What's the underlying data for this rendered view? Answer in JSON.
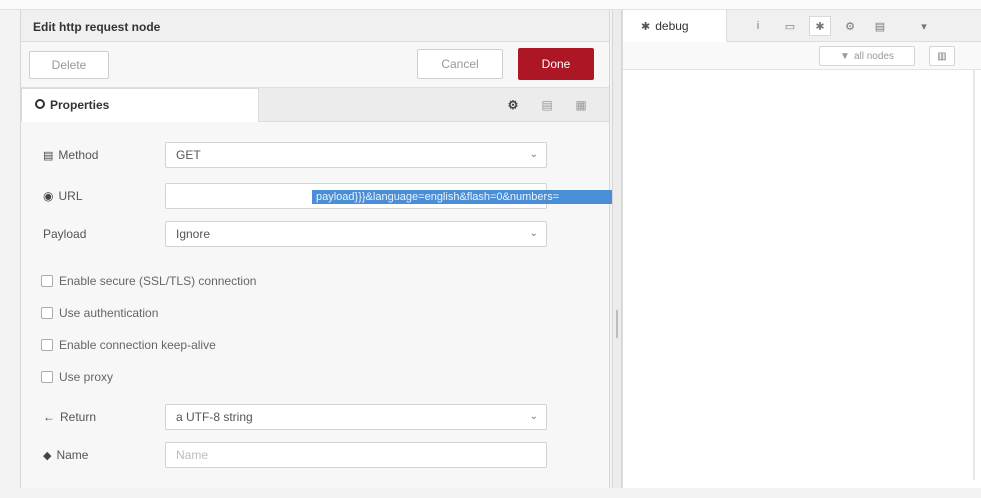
{
  "editor": {
    "title": "Edit http request node",
    "delete_label": "Delete",
    "cancel_label": "Cancel",
    "done_label": "Done",
    "tab_properties": "Properties"
  },
  "form": {
    "method_label": "Method",
    "method_value": "GET",
    "url_label": "URL",
    "url_value": "payload}}}&language=english&flash=0&numbers=",
    "payload_label": "Payload",
    "payload_value": "Ignore",
    "checkboxes": [
      "Enable secure (SSL/TLS) connection",
      "Use authentication",
      "Enable connection keep-alive",
      "Use proxy"
    ],
    "return_label": "Return",
    "return_value": "a UTF-8 string",
    "name_label": "Name",
    "name_placeholder": "Name"
  },
  "sidebar": {
    "tab_debug": "debug",
    "filter_label": "all nodes",
    "icons": [
      "info-icon",
      "book-icon",
      "bug-icon",
      "gear-icon",
      "database-icon",
      "chevron-down-icon"
    ]
  },
  "colors": {
    "done_button": "#ad1625",
    "url_selection": "#4a8fd6"
  }
}
